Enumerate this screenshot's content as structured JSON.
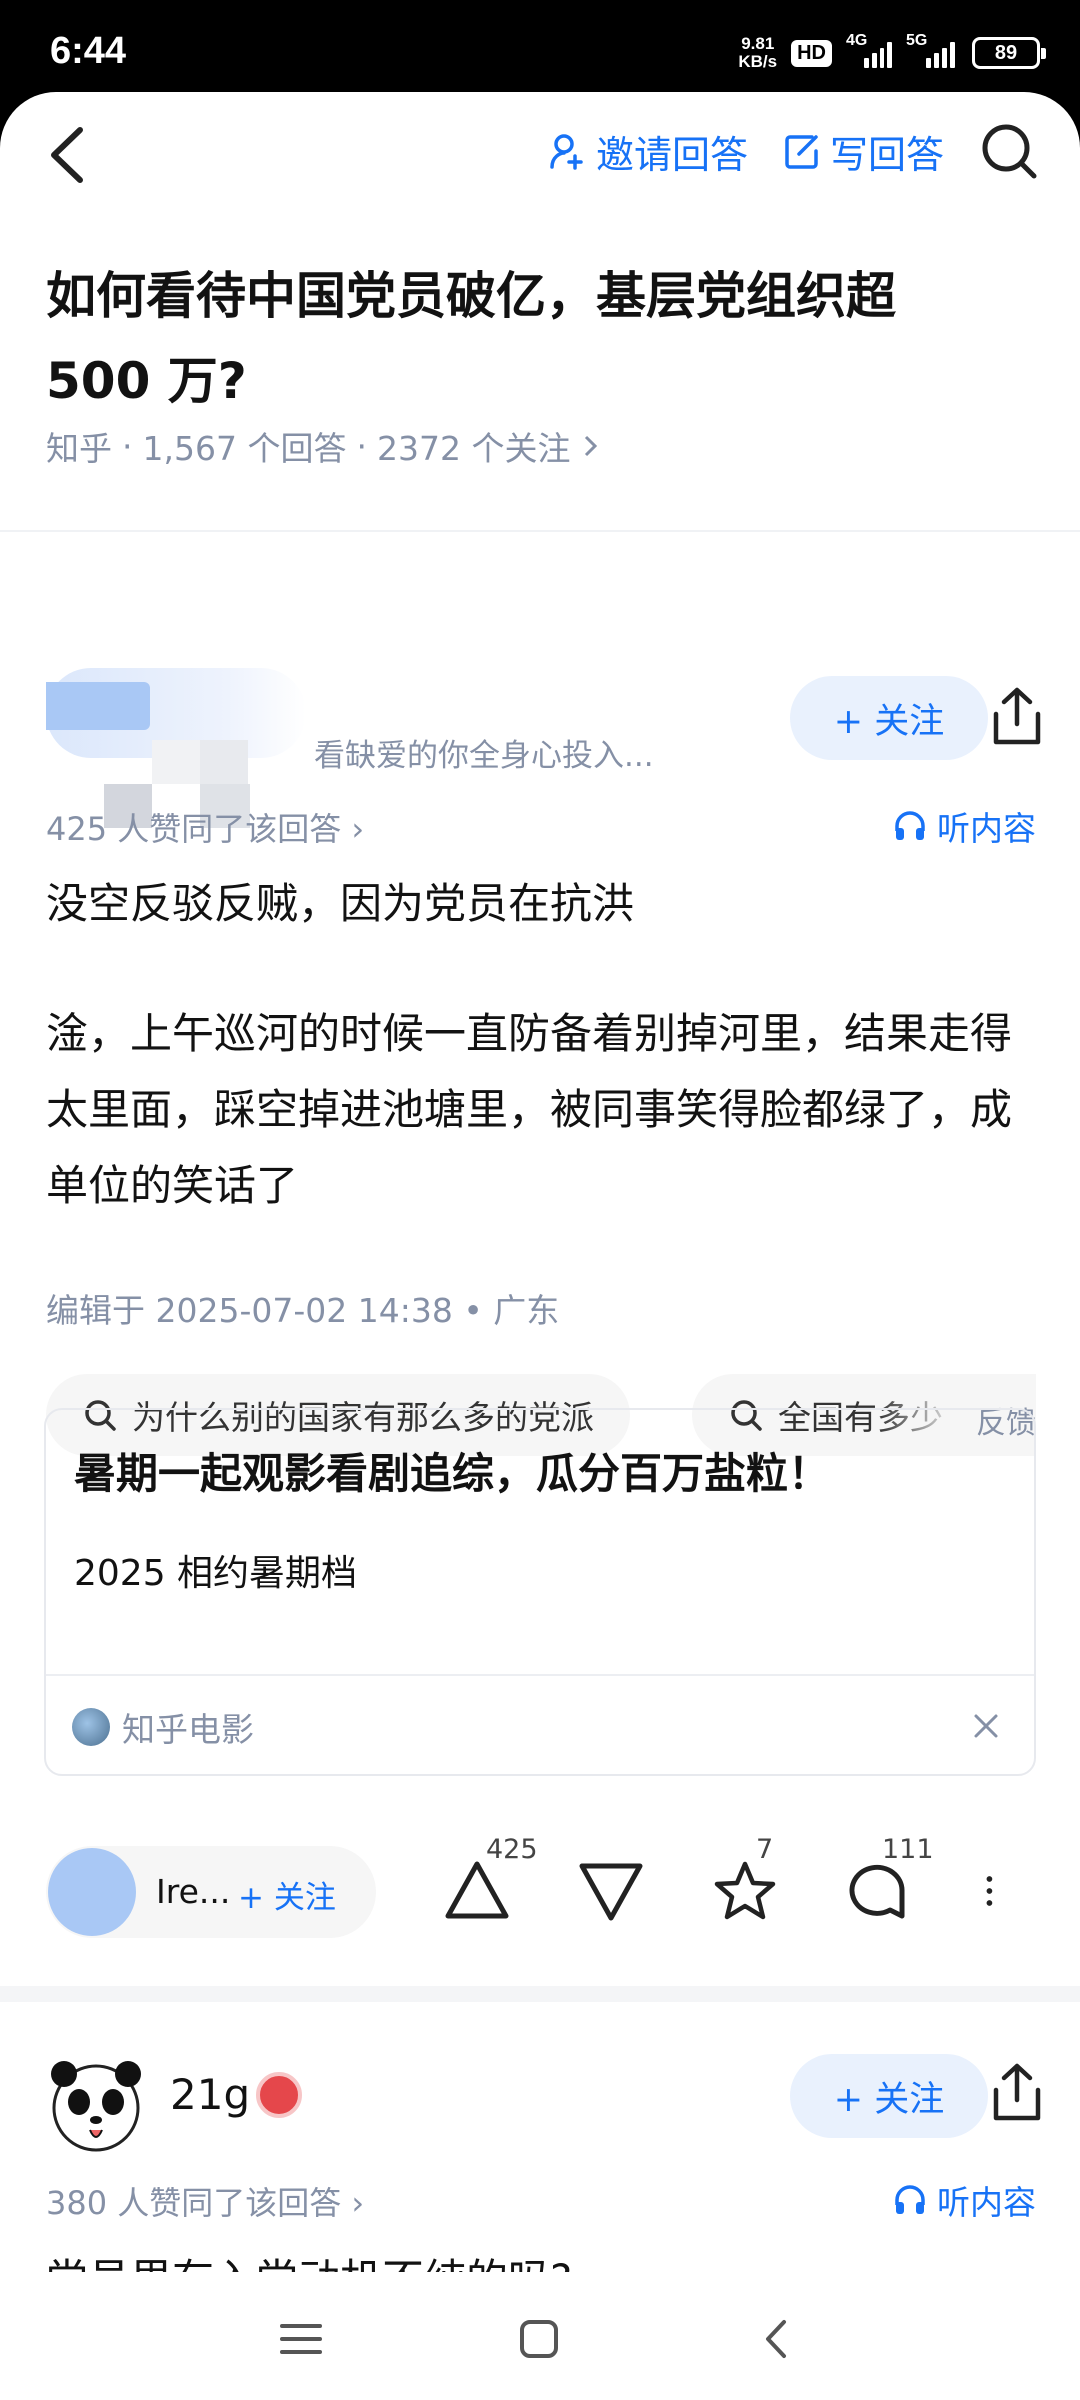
{
  "status_bar": {
    "time": "6:44",
    "net_speed_value": "9.81",
    "net_speed_unit": "KB/s",
    "hd_label": "HD",
    "sig1_label": "4G",
    "sig2_label": "5G",
    "battery": "89"
  },
  "nav": {
    "invite_label": "邀请回答",
    "write_label": "写回答"
  },
  "question": {
    "title": "如何看待中国党员破亿，基层党组织超 500 万?",
    "source": "知乎",
    "answers": "1,567 个回答",
    "follows": "2372 个关注",
    "sep": "·"
  },
  "answer1": {
    "bio": "看缺爱的你全身心投入...",
    "follow_label": "+ 关注",
    "vote_info": "425 人赞同了该回答 ›",
    "listen_label": "听内容",
    "para1": "没空反驳反贼，因为党员在抗洪",
    "para2": "淦，上午巡河的时候一直防备着别掉河里，结果走得太里面，踩空掉进池塘里，被同事笑得脸都绿了，成单位的笑话了",
    "edit_info": "编辑于 2025-07-02 14:38 • 广东",
    "related": [
      "为什么别的国家有那么多的党派",
      "全国有多少"
    ],
    "feedback": "反馈",
    "card": {
      "title": "暑期一起观影看剧追综，瓜分百万盐粒！",
      "subtitle": "2025 相约暑期档",
      "source": "知乎电影"
    },
    "actions": {
      "author_short": "Ire...",
      "follow_short": "+ 关注",
      "upvotes": "425",
      "favorites": "7",
      "comments": "111"
    }
  },
  "answer2": {
    "author": "21g",
    "follow_label": "+ 关注",
    "vote_info": "380 人赞同了该回答 ›",
    "listen_label": "听内容",
    "preview": "党员里有入党动机不纯的吗?"
  },
  "colors": {
    "accent": "#1772f6",
    "meta": "#8590a6"
  }
}
